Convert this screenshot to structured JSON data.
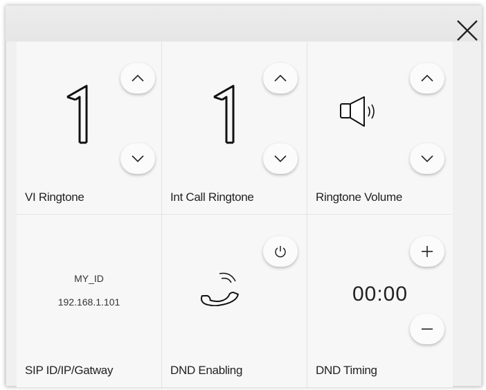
{
  "tiles": {
    "vi_ringtone": {
      "value": "1",
      "label": "VI Ringtone"
    },
    "int_call_ringtone": {
      "value": "1",
      "label": "Int Call Ringtone"
    },
    "ringtone_volume": {
      "label": "Ringtone Volume"
    },
    "sip": {
      "id": "MY_ID",
      "ip": "192.168.1.101",
      "label": "SIP ID/IP/Gatway"
    },
    "dnd_enabling": {
      "label": "DND Enabling"
    },
    "dnd_timing": {
      "time": "00:00",
      "label": "DND Timing"
    }
  },
  "icons": {
    "close": "close-icon",
    "up": "chevron-up-icon",
    "down": "chevron-down-icon",
    "speaker": "speaker-icon",
    "phone": "phone-icon",
    "power": "power-icon",
    "plus": "plus-icon",
    "minus": "minus-icon"
  },
  "colors": {
    "background": "#f0f0f0",
    "tile": "#f7f7f7",
    "text": "#222222"
  }
}
